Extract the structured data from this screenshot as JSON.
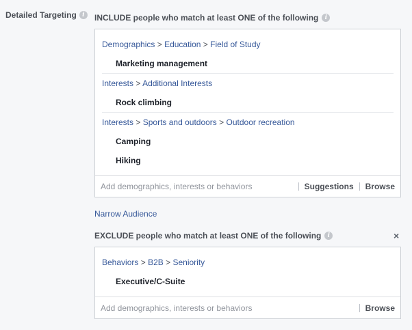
{
  "field_label": "Detailed Targeting",
  "include": {
    "title": "INCLUDE people who match at least ONE of the following",
    "groups": [
      {
        "path": [
          "Demographics",
          "Education",
          "Field of Study"
        ],
        "items": [
          "Marketing management"
        ]
      },
      {
        "path": [
          "Interests",
          "Additional Interests"
        ],
        "items": [
          "Rock climbing"
        ]
      },
      {
        "path": [
          "Interests",
          "Sports and outdoors",
          "Outdoor recreation"
        ],
        "items": [
          "Camping",
          "Hiking"
        ]
      }
    ],
    "placeholder": "Add demographics, interests or behaviors",
    "suggestions_label": "Suggestions",
    "browse_label": "Browse"
  },
  "narrow_audience_label": "Narrow Audience",
  "exclude": {
    "title": "EXCLUDE people who match at least ONE of the following",
    "close_symbol": "×",
    "groups": [
      {
        "path": [
          "Behaviors",
          "B2B",
          "Seniority"
        ],
        "items": [
          "Executive/C-Suite"
        ]
      }
    ],
    "placeholder": "Add demographics, interests or behaviors",
    "browse_label": "Browse"
  },
  "path_separator": ">",
  "info_icon_glyph": "i",
  "colors": {
    "link": "#365899",
    "label": "#4b4f56",
    "placeholder": "#90949c",
    "border": "#ccd0d5"
  }
}
